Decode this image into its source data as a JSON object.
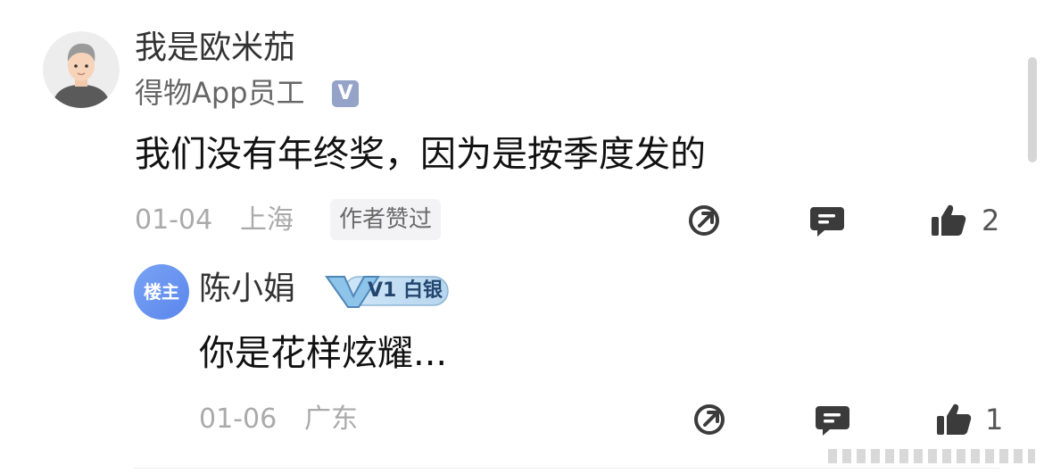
{
  "comment": {
    "username": "我是欧米茄",
    "user_title": "得物App员工",
    "verified_icon": "verified-v-icon",
    "text": "我们没有年终奖，因为是按季度发的",
    "date": "01-04",
    "location": "上海",
    "author_liked_tag": "作者赞过",
    "like_count": "2"
  },
  "reply": {
    "avatar_label": "楼主",
    "username": "陈小娟",
    "level_badge": "V1 白银",
    "text": "你是花样炫耀...",
    "date": "01-06",
    "location": "广东",
    "like_count": "1"
  },
  "colors": {
    "meta_text": "#aaaaaa",
    "op_avatar": "#5a86ec",
    "verified_badge": "#95a3c8",
    "icon": "#3b3b3b"
  }
}
